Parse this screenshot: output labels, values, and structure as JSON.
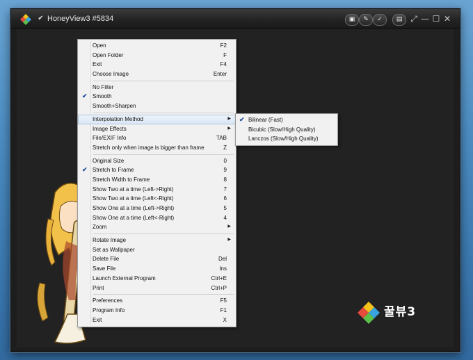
{
  "window": {
    "title": "HoneyView3 #5834",
    "title_buttons": [
      {
        "icon": "window-toggle-icon",
        "glyph": "▣"
      },
      {
        "icon": "edit-icon",
        "glyph": "✎"
      },
      {
        "icon": "check-icon",
        "glyph": "✓"
      },
      {
        "icon": "settings-icon",
        "glyph": "▤"
      }
    ],
    "window_controls": [
      {
        "icon": "fullscreen-icon",
        "glyph": "⤢"
      },
      {
        "icon": "minimize-icon",
        "glyph": "—"
      },
      {
        "icon": "maximize-icon",
        "glyph": "☐"
      },
      {
        "icon": "close-icon",
        "glyph": "✕"
      }
    ]
  },
  "brand": {
    "text": "꿀뷰3"
  },
  "menu": {
    "items": [
      {
        "label": "Open",
        "shortcut": "F2"
      },
      {
        "label": "Open Folder",
        "shortcut": "F"
      },
      {
        "label": "Exit",
        "shortcut": "F4"
      },
      {
        "label": "Choose Image",
        "shortcut": "Enter"
      },
      {
        "label": "No Filter",
        "shortcut": ""
      },
      {
        "label": "Smooth",
        "shortcut": "",
        "checked": "✔"
      },
      {
        "label": "Smooth+Sharpen",
        "shortcut": ""
      },
      {
        "label": "Interpolation Method",
        "shortcut": "",
        "submenu": "▶"
      },
      {
        "label": "Image Effects",
        "shortcut": "",
        "submenu": "▶"
      },
      {
        "label": "File/EXIF Info",
        "shortcut": "TAB"
      },
      {
        "label": "Stretch only when image is bigger than frame",
        "shortcut": "Z"
      },
      {
        "label": "Original Size",
        "shortcut": "0"
      },
      {
        "label": "Stretch to Frame",
        "shortcut": "9",
        "checked": "✔"
      },
      {
        "label": "Stretch Width to Frame",
        "shortcut": "8"
      },
      {
        "label": "Show Two at a time (Left->Right)",
        "shortcut": "7"
      },
      {
        "label": "Show Two at a time (Left<-Right)",
        "shortcut": "6"
      },
      {
        "label": "Show One at a time (Left->Right)",
        "shortcut": "5"
      },
      {
        "label": "Show One at a time (Left<-Right)",
        "shortcut": "4"
      },
      {
        "label": "Zoom",
        "shortcut": "",
        "submenu": "▶"
      },
      {
        "label": "Rotate Image",
        "shortcut": "",
        "submenu": "▶"
      },
      {
        "label": "Set as Wallpaper",
        "shortcut": ""
      },
      {
        "label": "Delete File",
        "shortcut": "Del"
      },
      {
        "label": "Save File",
        "shortcut": "Ins"
      },
      {
        "label": "Launch External Program",
        "shortcut": "Ctrl+E"
      },
      {
        "label": "Print",
        "shortcut": "Ctrl+P"
      },
      {
        "label": "Preferences",
        "shortcut": "F5"
      },
      {
        "label": "Program Info",
        "shortcut": "F1"
      },
      {
        "label": "Exit",
        "shortcut": "X"
      }
    ]
  },
  "submenu": {
    "items": [
      {
        "label": "Bilinear (Fast)",
        "checked": "✔"
      },
      {
        "label": "Bicubic (Slow/High Quality)"
      },
      {
        "label": "Lanczos (Slow/High Quality)"
      }
    ]
  },
  "colors": {
    "desktop": "#4e8fc4",
    "window_bg": "#1d1d1d",
    "menu_bg": "#f1f1f1",
    "check": "#1f4e9c",
    "highlight": "#d9e6f5"
  }
}
